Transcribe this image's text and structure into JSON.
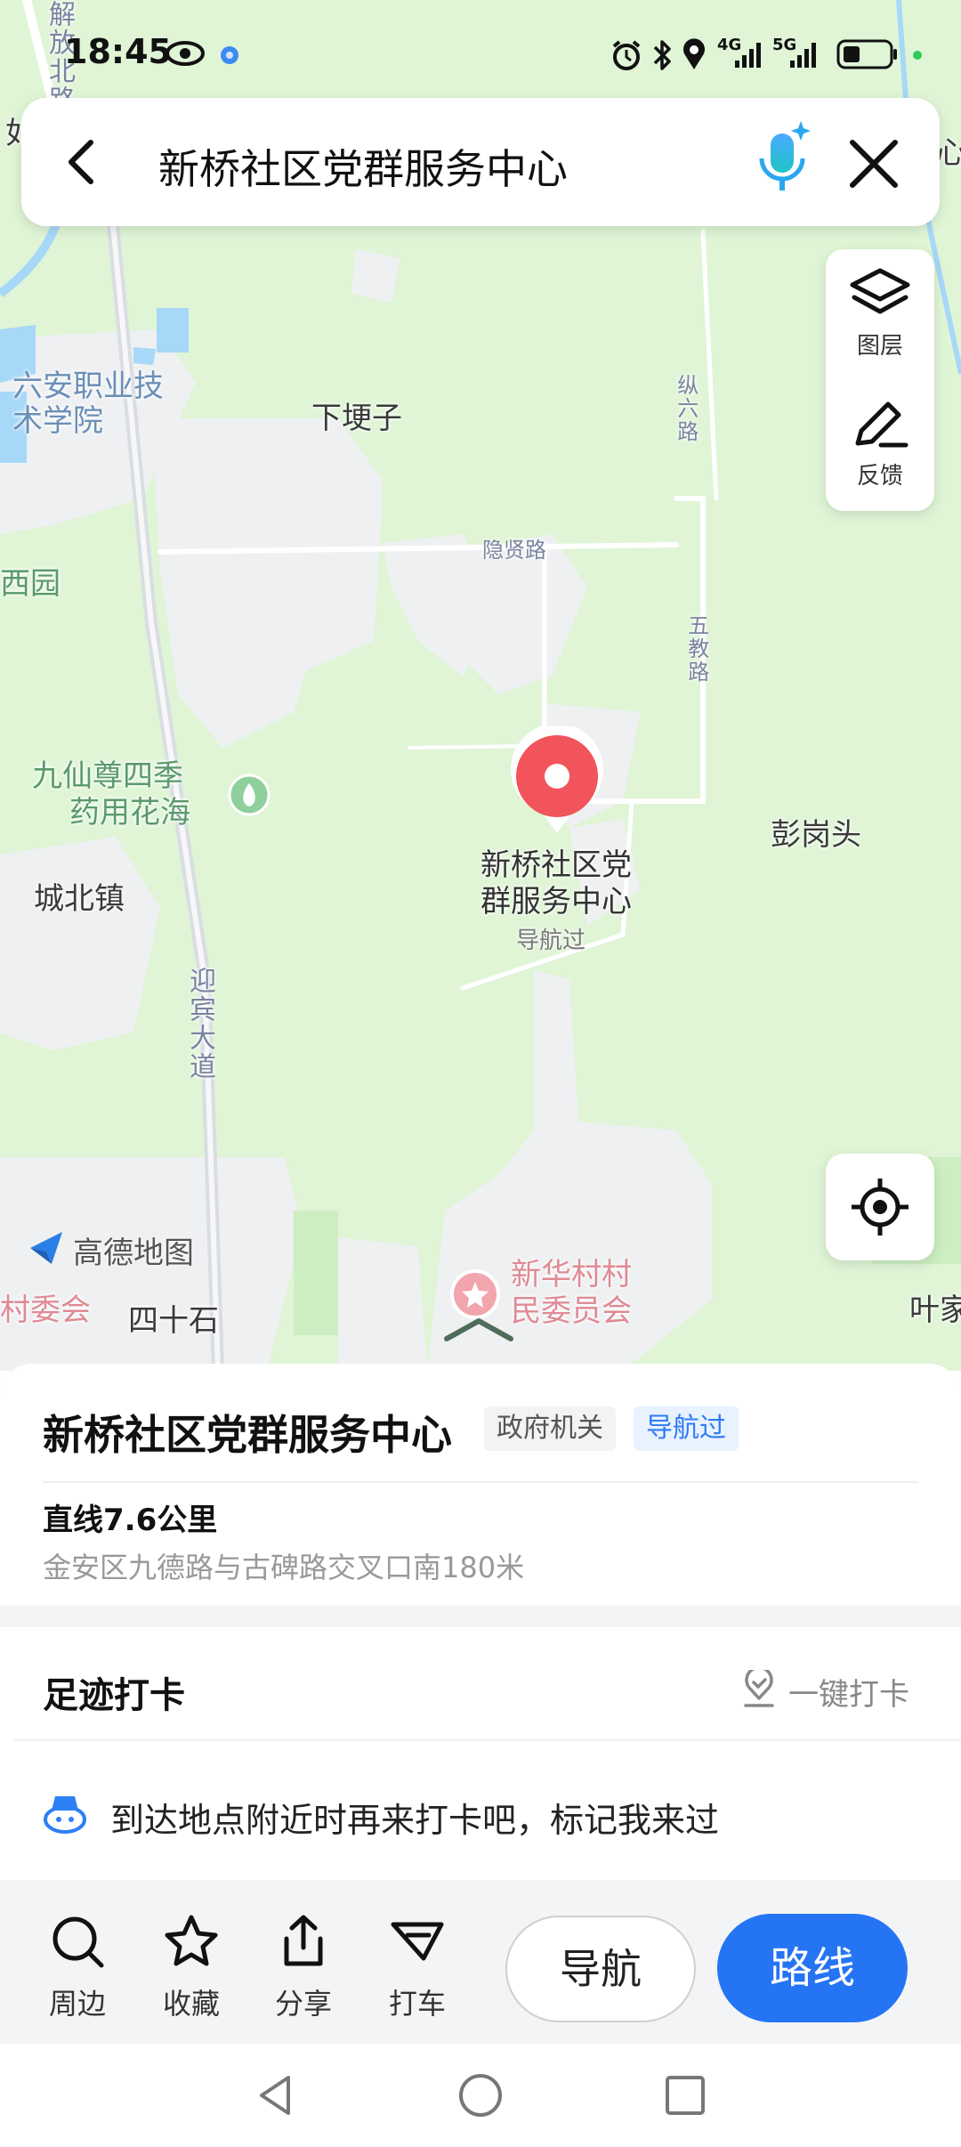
{
  "status_bar": {
    "time": "18:45",
    "network_1": "4G",
    "network_2": "5G"
  },
  "search": {
    "query": "新桥社区党群服务中心"
  },
  "map": {
    "tools": [
      {
        "label": "图层",
        "icon": "layers-icon"
      },
      {
        "label": "反馈",
        "icon": "edit-feedback-icon"
      }
    ],
    "brand": "高德地图",
    "marker": {
      "title_line1": "新桥社区党",
      "title_line2": "群服务中心",
      "subtitle": "导航过"
    },
    "labels": {
      "liuan_college": "六安职业技术学院",
      "xiagengzi": "下埂子",
      "jiuxian_line1": "九仙尊四季",
      "jiuxian_line2": "药用花海",
      "chengbei": "城北镇",
      "penggangtou": "彭岗头",
      "sishishi": "四十石",
      "cunweihui": "村委会",
      "xinhua_line1": "新华村村",
      "xinhua_line2": "民委员会",
      "yejia": "叶家",
      "xiyuan": "西园",
      "road_yinxian": "隐贤路",
      "road_zongliu": "纵六路",
      "road_wujiao": "五教路",
      "road_yingbin": "迎宾大道",
      "road_jiefang": "解放北路",
      "edge_left": "如",
      "edge_right": "心"
    },
    "colors": {
      "land": "#dff5d6",
      "urban": "#eef0f2",
      "water": "#a8d8f8",
      "marker": "#f2545b"
    }
  },
  "place": {
    "name": "新桥社区党群服务中心",
    "category_tag": "政府机关",
    "visited_tag": "导航过",
    "distance": "直线7.6公里",
    "address": "金安区九德路与古碑路交叉口南180米"
  },
  "checkin": {
    "title": "足迹打卡",
    "action": "一键打卡",
    "message": "到达地点附近时再来打卡吧，标记我来过"
  },
  "actions": [
    {
      "label": "周边",
      "icon": "search-icon"
    },
    {
      "label": "收藏",
      "icon": "star-icon"
    },
    {
      "label": "分享",
      "icon": "share-icon"
    },
    {
      "label": "打车",
      "icon": "taxi-icon"
    }
  ],
  "buttons": {
    "navigate": "导航",
    "route": "路线"
  },
  "accent_color": "#2574f4"
}
